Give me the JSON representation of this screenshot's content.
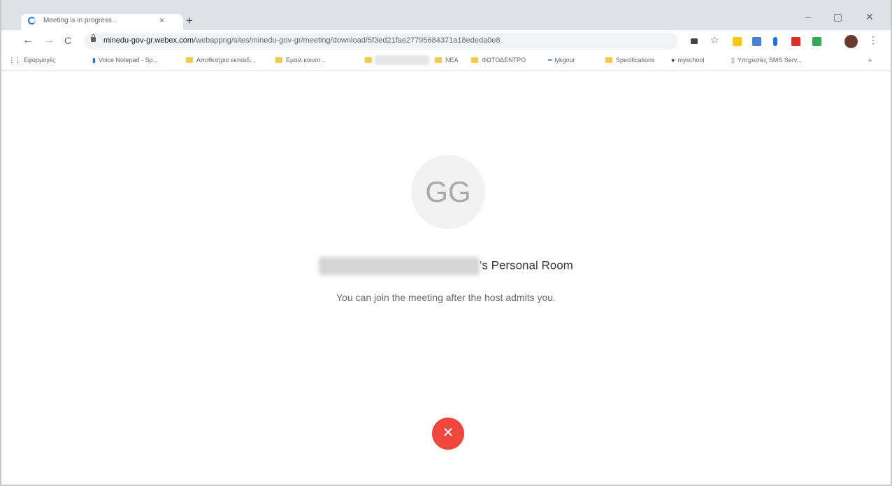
{
  "browser": {
    "tab_title": "Meeting is in progress...",
    "tab_close": "×",
    "new_tab": "+",
    "controls": {
      "minimize": "–",
      "maximize": "▢",
      "close": "✕"
    },
    "nav": {
      "back": "←",
      "forward": "→",
      "reload": "C"
    },
    "url_host": "minedu-gov-gr.webex.com",
    "url_path": "/webappng/sites/minedu-gov-gr/meeting/download/5f3ed21fae27795684371a18ededa0e8",
    "bookmarks": [
      {
        "label": "Εφαρμογές",
        "type": "apps"
      },
      {
        "label": "Voice Notepad - Sp...",
        "type": "link"
      },
      {
        "label": "Αποθετήριο εκπαιδ...",
        "type": "folder"
      },
      {
        "label": "Εμαιλ κοινοτ...",
        "type": "folder"
      },
      {
        "label": "ΝΕΑ",
        "type": "folder"
      },
      {
        "label": "ΦΩΤΟΔΕΝΤΡΟ",
        "type": "folder"
      },
      {
        "label": "lykgour",
        "type": "link"
      },
      {
        "label": "Specifications",
        "type": "folder"
      },
      {
        "label": "myschool",
        "type": "link"
      },
      {
        "label": "Υπηρεσίες SMS Serv...",
        "type": "link"
      }
    ],
    "more": "»"
  },
  "meeting": {
    "avatar_initials": "GG",
    "room_suffix": "'s Personal Room",
    "message": "You can join the meeting after the host admits you.",
    "leave_icon": "✕"
  },
  "colors": {
    "accent": "#1a73e8",
    "leave_button": "#f0463c"
  }
}
